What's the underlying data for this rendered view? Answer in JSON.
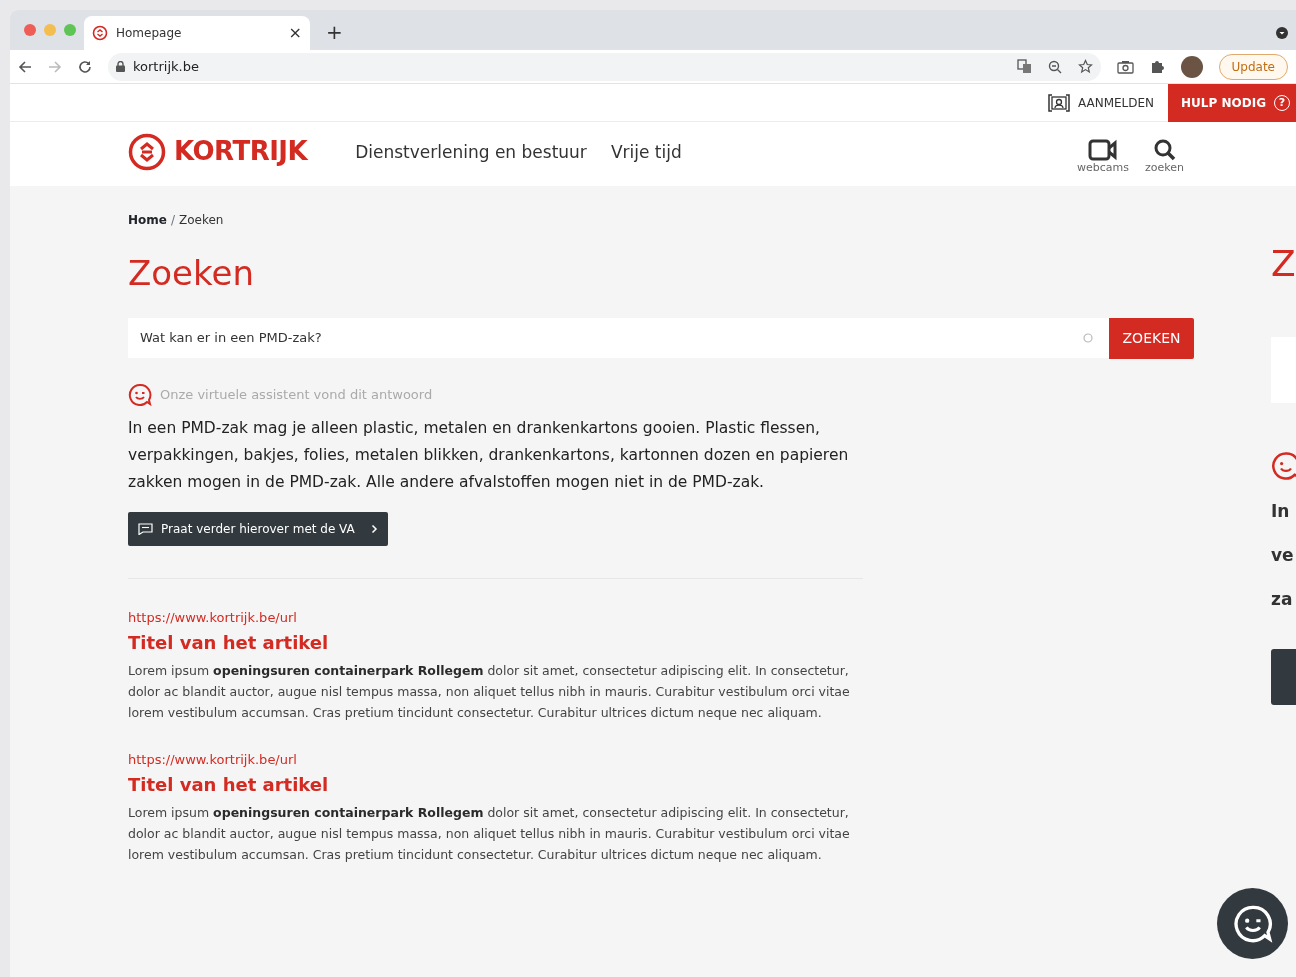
{
  "browser": {
    "tab": {
      "title": "Homepage",
      "close": "×"
    },
    "new_tab": "+",
    "address": "kortrijk.be",
    "update_button": "Update"
  },
  "utility_bar": {
    "login": "AANMELDEN",
    "help": "HULP NODIG",
    "help_icon": "?"
  },
  "header": {
    "logo": "KORTRIJK",
    "nav": [
      "Dienstverlening en bestuur",
      "Vrije tijd"
    ],
    "tools": [
      {
        "label": "webcams",
        "kind": "camera"
      },
      {
        "label": "zoeken",
        "kind": "search"
      }
    ]
  },
  "breadcrumb_separator": "/",
  "breadcrumb": [
    {
      "label": "Home",
      "current": false
    },
    {
      "label": "Zoeken",
      "current": true
    }
  ],
  "page_title": "Zoeken",
  "search": {
    "value": "Wat kan er in een PMD-zak?",
    "button": "ZOEKEN"
  },
  "assistant": {
    "caption": "Onze virtuele assistent vond dit antwoord",
    "answer": "In een PMD-zak mag je alleen plastic, metalen en drankenkartons gooien. Plastic flessen, verpakkingen, bakjes, folies, metalen blikken, drankenkartons, kartonnen dozen en papieren zakken mogen in de PMD-zak. Alle andere afvalstoffen mogen niet in de PMD-zak.",
    "button": "Praat verder hierover met de VA"
  },
  "results": [
    {
      "url": "https://www.kortrijk.be/url",
      "title": "Titel van het artikel",
      "snippet": "Lorem ipsum **openingsuren containerpark Rollegem** dolor sit amet, consectetur adipiscing elit. In consectetur, dolor ac blandit auctor, augue nisl tempus massa, non aliquet tellus nibh in mauris. Curabitur vestibulum orci vitae lorem vestibulum accumsan. Cras pretium tincidunt consectetur. Curabitur ultrices dictum neque nec aliquam."
    },
    {
      "url": "https://www.kortrijk.be/url",
      "title": "Titel van het artikel",
      "snippet": "Lorem ipsum **openingsuren containerpark Rollegem** dolor sit amet, consectetur adipiscing elit. In consectetur, dolor ac blandit auctor, augue nisl tempus massa, non aliquet tellus nibh in mauris. Curabitur vestibulum orci vitae lorem vestibulum accumsan. Cras pretium tincidunt consectetur. Curabitur ultrices dictum neque nec aliquam."
    }
  ],
  "side_peek": {
    "title": "Z",
    "lines": [
      "In",
      "ve",
      "za"
    ]
  }
}
